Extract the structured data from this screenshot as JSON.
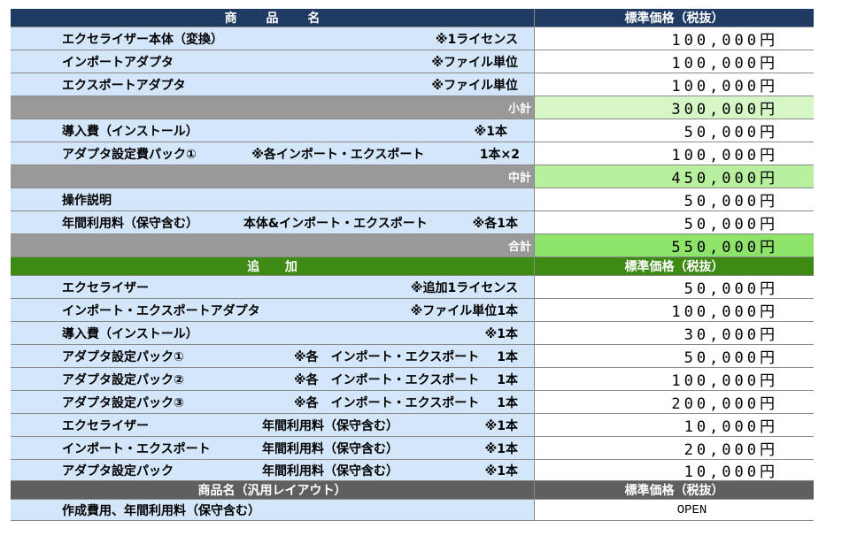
{
  "sections": {
    "main_header": {
      "left": "商 品 名",
      "right": "標準価格（税抜）"
    },
    "main_items_a": [
      {
        "name": "エクセライザー本体（変換）",
        "note": "※1ライセンス",
        "price": "100,000円"
      },
      {
        "name": "インポートアダプタ",
        "note": "※ファイル単位",
        "price": "100,000円"
      },
      {
        "name": "エクスポートアダプタ",
        "note": "※ファイル単位",
        "price": "100,000円"
      }
    ],
    "subtotal": {
      "label": "小計",
      "price": "300,000円"
    },
    "main_items_b": [
      {
        "name": "導入費（インストール）",
        "note": "※1本",
        "price": "50,000円"
      },
      {
        "name": "アダプタ設定費パック①",
        "mid": "※各インポート・エクスポート",
        "note": "1本×2",
        "price": "100,000円"
      }
    ],
    "midtotal": {
      "label": "中計",
      "price": "450,000円"
    },
    "main_items_c": [
      {
        "name": "操作説明",
        "note": "",
        "price": "50,000円"
      },
      {
        "name": "年間利用料（保守含む）",
        "mid": "本体&インポート・エクスポート",
        "note": "※各1本",
        "price": "50,000円"
      }
    ],
    "total": {
      "label": "合計",
      "price": "550,000円"
    },
    "addon_header": {
      "left": "追 加",
      "right": "標準価格（税抜）"
    },
    "addon_items": [
      {
        "name": "エクセライザー",
        "note": "※追加1ライセンス",
        "price": "50,000円"
      },
      {
        "name": "インポート・エクスポートアダプタ",
        "note": "※ファイル単位1本",
        "price": "100,000円"
      },
      {
        "name": "導入費（インストール）",
        "note": "※1本",
        "price": "30,000円"
      },
      {
        "name": "アダプタ設定パック①",
        "mid": "※各　インポート・エクスポート",
        "note": "1本",
        "price": "50,000円"
      },
      {
        "name": "アダプタ設定パック②",
        "mid": "※各　インポート・エクスポート",
        "note": "1本",
        "price": "100,000円"
      },
      {
        "name": "アダプタ設定パック③",
        "mid": "※各　インポート・エクスポート",
        "note": "1本",
        "price": "200,000円"
      },
      {
        "name": "エクセライザー",
        "mid": "年間利用料（保守含む）",
        "note": "※1本",
        "price": "10,000円"
      },
      {
        "name": "インポート・エクスポート",
        "mid": "年間利用料（保守含む）",
        "note": "※1本",
        "price": "20,000円"
      },
      {
        "name": "アダプタ設定パック",
        "mid": "年間利用料（保守含む）",
        "note": "※1本",
        "price": "10,000円"
      }
    ],
    "generic_header": {
      "left": "商品名（汎用レイアウト）",
      "right": "標準価格（税抜）"
    },
    "generic_items": [
      {
        "name": "作成費用、年間利用料（保守含む）",
        "price": "OPEN"
      }
    ]
  }
}
